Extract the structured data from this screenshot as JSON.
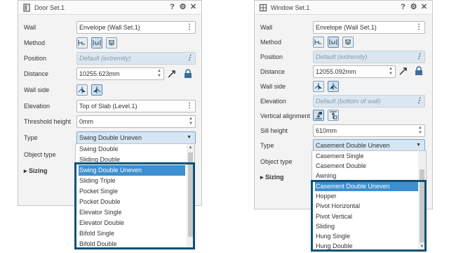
{
  "left": {
    "title": "Door Set.1",
    "wall": {
      "label": "Wall",
      "value": "Envelope (Wall Set.1)"
    },
    "method": {
      "label": "Method"
    },
    "position": {
      "label": "Position",
      "value": "Default (extremity)"
    },
    "distance": {
      "label": "Distance",
      "value": "10255.623mm"
    },
    "wall_side": {
      "label": "Wall side"
    },
    "elevation": {
      "label": "Elevation",
      "value": "Top of Slab (Level.1)"
    },
    "threshold": {
      "label": "Threshold height",
      "value": "0mm"
    },
    "type": {
      "label": "Type",
      "value": "Swing Double Uneven"
    },
    "object_type": {
      "label": "Object type"
    },
    "sizing": {
      "label": "Sizing"
    },
    "options": [
      "Swing Double",
      "Sliding Double",
      "Swing Double Uneven",
      "Sliding Triple",
      "Pocket Single",
      "Pocket Double",
      "Elevator Single",
      "Elevator Double",
      "Bifold Single",
      "Bifold Double"
    ]
  },
  "right": {
    "title": "Window Set.1",
    "wall": {
      "label": "Wall",
      "value": "Envelope (Wall Set.1)"
    },
    "method": {
      "label": "Method"
    },
    "position": {
      "label": "Position",
      "value": "Default (extremity)"
    },
    "distance": {
      "label": "Distance",
      "value": "12055.092mm"
    },
    "wall_side": {
      "label": "Wall side"
    },
    "elevation": {
      "label": "Elevation",
      "value": "Default (bottom of wall)"
    },
    "vertical_alignment": {
      "label": "Vertical alignment"
    },
    "sill": {
      "label": "Sill height",
      "value": "610mm"
    },
    "type": {
      "label": "Type",
      "value": "Casement Double Uneven"
    },
    "object_type": {
      "label": "Object type"
    },
    "sizing": {
      "label": "Sizing"
    },
    "options": [
      "Casement Single",
      "Casement Double",
      "Awning",
      "Casement Double Uneven",
      "Hopper",
      "Pivot Horizontal",
      "Pivot Vertical",
      "Sliding",
      "Hung Single",
      "Hung Double"
    ]
  },
  "colors": {
    "highlight": "#3e8fd0",
    "frame": "#0c5277",
    "disabled_field": "#dbe7f0"
  }
}
